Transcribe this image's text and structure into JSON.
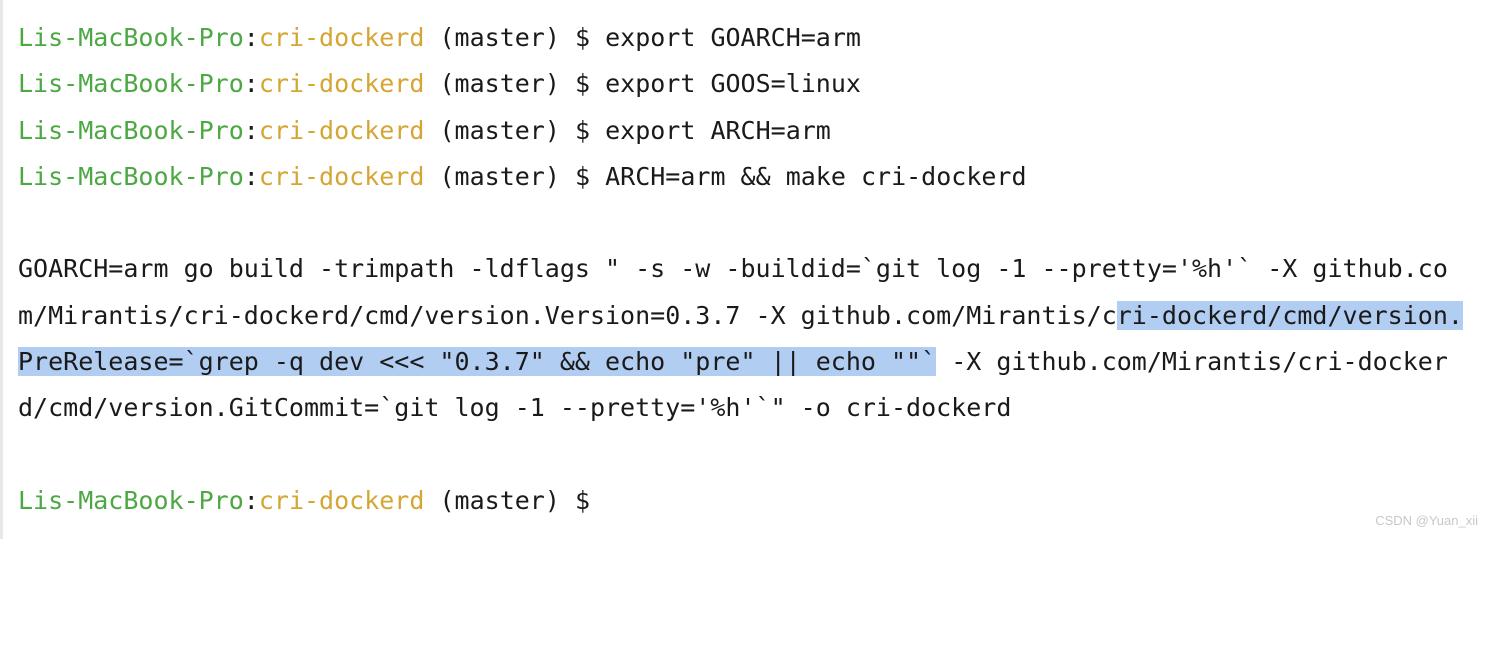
{
  "prompt": {
    "host": "Lis-MacBook-Pro",
    "colon": ":",
    "dir": "cri-dockerd",
    "branch": "(master)",
    "dollar": "$"
  },
  "lines": [
    {
      "cmd": "export GOARCH=arm"
    },
    {
      "cmd": "export GOOS=linux"
    },
    {
      "cmd": "export ARCH=arm"
    },
    {
      "cmd": "ARCH=arm && make cri-dockerd"
    }
  ],
  "build_output": {
    "pre": "GOARCH=arm go build -trimpath -ldflags \" -s -w -buildid=`git log -1 --pretty='%h'` -X github.com/Mirantis/cri-dockerd/cmd/version.Version=0.3.7 -X github.com/Mirantis/c",
    "sel": "ri-dockerd/cmd/version.PreRelease=`grep -q dev <<< \"0.3.7\" && echo \"pre\" || echo \"\"`",
    "post": " -X github.com/Mirantis/cri-dockerd/cmd/version.GitCommit=`git log -1 --pretty='%h'`\" -o cri-dockerd"
  },
  "watermark": "CSDN @Yuan_xii"
}
